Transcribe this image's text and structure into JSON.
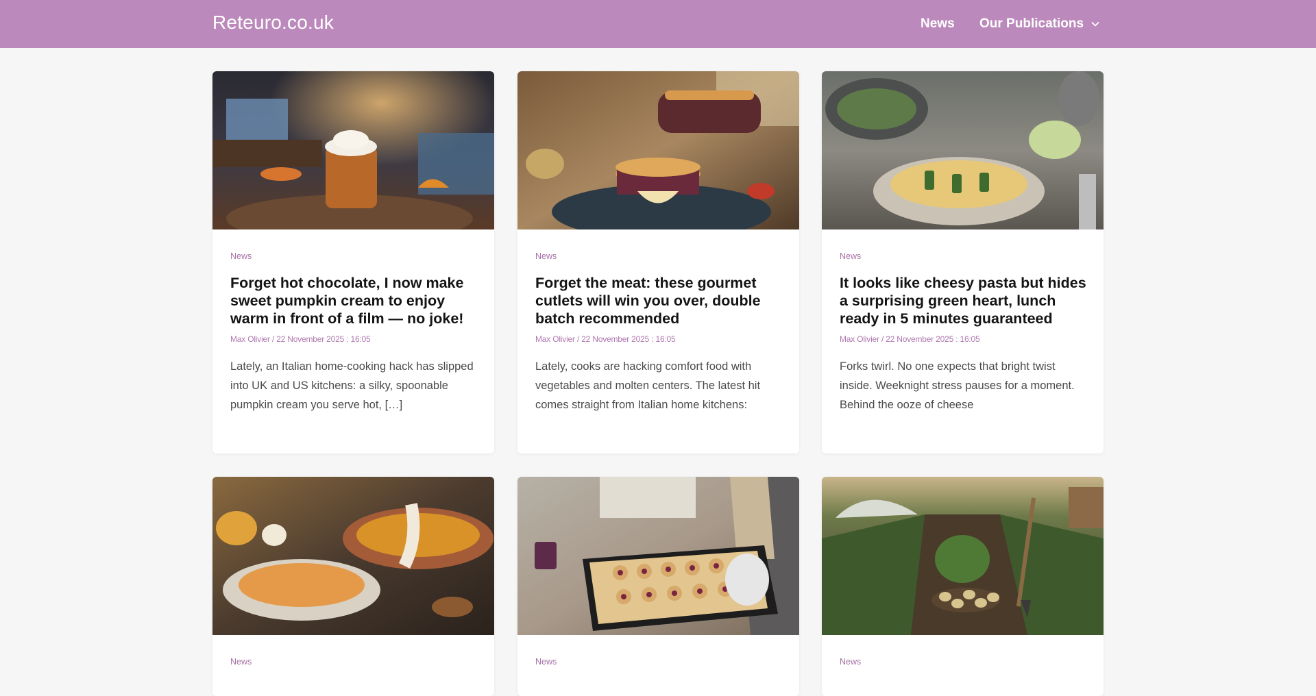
{
  "header": {
    "site_title": "Reteuro.co.uk",
    "nav": {
      "news": "News",
      "publications": "Our Publications"
    },
    "colors": {
      "background": "#bb89bb",
      "text": "#ffffff"
    }
  },
  "articles": [
    {
      "category": "News",
      "title": "Forget hot chocolate, I now make sweet pumpkin cream to enjoy warm in front of a film — no joke!",
      "meta": "Max Olivier / 22 November 2025 : 16:05",
      "excerpt": "Lately, an Italian home-cooking hack has slipped into UK and US kitchens: a silky, spoonable pumpkin cream you serve hot, […]",
      "image": "pumpkin-cream-mug-photo"
    },
    {
      "category": "News",
      "title": "Forget the meat: these gourmet cutlets will win you over, double batch recommended",
      "meta": "Max Olivier / 22 November 2025 : 16:05",
      "excerpt": "Lately, cooks are hacking comfort food with vegetables and molten centers. The latest hit comes straight from Italian home kitchens:",
      "image": "eggplant-cutlets-photo"
    },
    {
      "category": "News",
      "title": "It looks like cheesy pasta but hides a surprising green heart, lunch ready in 5 minutes guaranteed",
      "meta": "Max Olivier / 22 November 2025 : 16:05",
      "excerpt": "Forks twirl. No one expects that bright twist inside. Weeknight stress pauses for a moment. Behind the ooze of cheese",
      "image": "zucchini-pasta-photo"
    },
    {
      "category": "News",
      "image": "pumpkin-pasta-photo"
    },
    {
      "category": "News",
      "image": "jam-cookies-photo"
    },
    {
      "category": "News",
      "image": "potato-garden-photo"
    }
  ],
  "colors": {
    "accent": "#a674a6",
    "page_background": "#f6f6f6",
    "card_background": "#ffffff"
  }
}
